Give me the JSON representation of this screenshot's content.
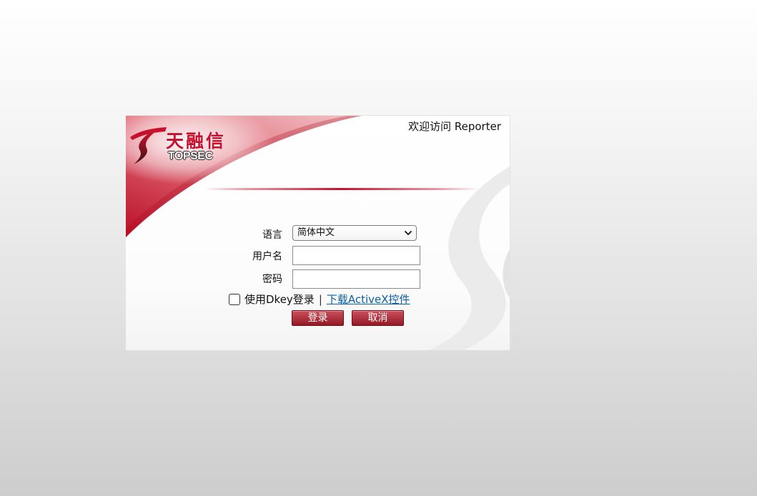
{
  "header": {
    "welcome_text": "欢迎访问 Reporter"
  },
  "logo": {
    "brand_cn": "天融信",
    "brand_en": "TOPSEC",
    "mark_icon": "topsec-logo-mark-icon"
  },
  "form": {
    "language": {
      "label": "语言",
      "selected": "简体中文",
      "icon": "chevron-down-icon"
    },
    "username": {
      "label": "用户名",
      "value": ""
    },
    "password": {
      "label": "密码",
      "value": ""
    },
    "dkey": {
      "label": "使用Dkey登录",
      "checked": false
    },
    "separator": "|",
    "activex_link": "下载ActiveX控件"
  },
  "buttons": {
    "login": "登录",
    "cancel": "取消"
  },
  "colors": {
    "brand_red": "#c8102e",
    "link_blue": "#0b5fa5",
    "button_top": "#c9505c",
    "button_bottom": "#951826"
  }
}
